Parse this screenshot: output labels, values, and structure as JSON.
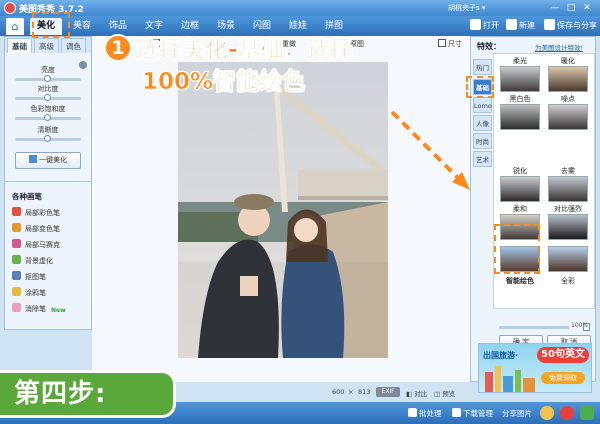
{
  "app": {
    "title": "美图秀秀 3.7.2",
    "account": "胡桃夹子s ▾"
  },
  "window_controls": {
    "min": "—",
    "max": "□",
    "close": "✕"
  },
  "menu": {
    "home_icon": "home-icon",
    "tabs": [
      "美化",
      "美容",
      "饰品",
      "文字",
      "边框",
      "场景",
      "闪图",
      "娃娃",
      "拼图"
    ],
    "active_tab": "美化"
  },
  "toolbar": {
    "open": "打开",
    "new": "新建",
    "save": "保存与分享"
  },
  "left_panel": {
    "tabs": [
      "基础",
      "高级",
      "调色"
    ],
    "active_tab": "基础",
    "sliders": [
      {
        "label": "亮度",
        "value": 0.5
      },
      {
        "label": "对比度",
        "value": 0.5
      },
      {
        "label": "色彩饱和度",
        "value": 0.5
      },
      {
        "label": "清晰度",
        "value": 0.5
      }
    ],
    "one_click_label": "一键美化",
    "brush_title": "各种画笔",
    "brushes": [
      "局部彩色笔",
      "局部变色笔",
      "局部马赛克",
      "背景虚化",
      "抠图笔",
      "涂鸦笔",
      "消除笔"
    ],
    "new_badge": "New"
  },
  "canvas": {
    "tools": [
      "撤销",
      "重做",
      "原图",
      "尺寸"
    ],
    "width": "600",
    "times": "×",
    "height": "813",
    "exif": "EXIF",
    "compare": "对比",
    "preview": "预览"
  },
  "effects": {
    "title": "特效：",
    "link": "为美图设计特效!",
    "categories": [
      "热门",
      "基础",
      "Lomo",
      "人像",
      "时尚",
      "艺术"
    ],
    "active_category": "基础",
    "items": [
      "柔光",
      "暖化",
      "黑白色",
      "噪点",
      "锐化",
      "去雾",
      "柔和",
      "对比强烈",
      "智能绘色",
      "全彩"
    ],
    "selected": "智能绘色",
    "opacity": "100%",
    "confirm": "确 定",
    "cancel": "取 消"
  },
  "ad": {
    "text1": "出国旅游·",
    "text2": "50句英文",
    "text3": "免费领取"
  },
  "bottom": {
    "batch": "批处理",
    "download": "下载管理",
    "share": "分享图片"
  },
  "tutorial": {
    "step_number": "1",
    "line1": "选择美化-基础，选择",
    "line2": "100%智能绘色",
    "banner": "第四步:"
  },
  "colors": {
    "accent": "#ff8a1c",
    "banner": "#5aa83a",
    "chrome": "#3f86cf"
  }
}
